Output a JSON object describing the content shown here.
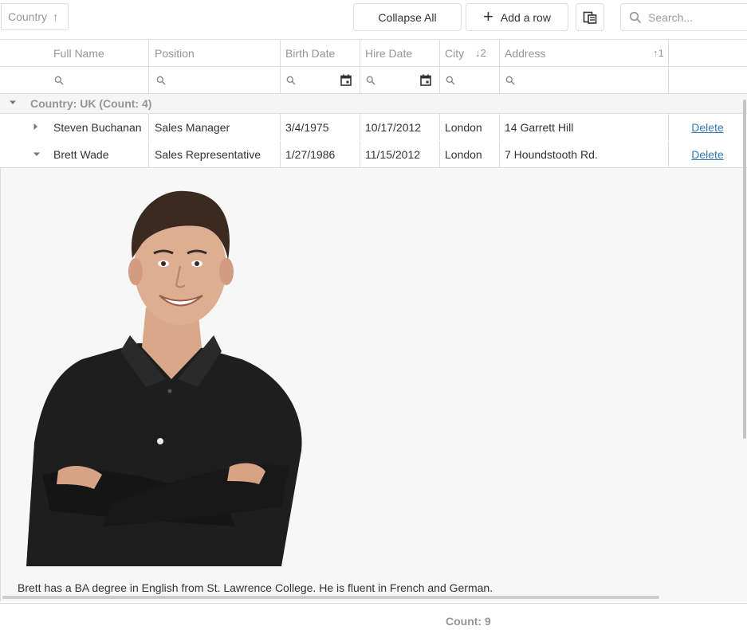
{
  "toolbar": {
    "group_panel_chip": "Country",
    "collapse_all_label": "Collapse All",
    "add_row_label": "Add a row",
    "search_placeholder": "Search..."
  },
  "columns": [
    {
      "label": "Full Name"
    },
    {
      "label": "Position"
    },
    {
      "label": "Birth Date"
    },
    {
      "label": "Hire Date"
    },
    {
      "label": "City",
      "sort_index": "2"
    },
    {
      "label": "Address",
      "sort_index": "1"
    }
  ],
  "group": {
    "label": "Country: UK (Count: 4)"
  },
  "rows": [
    {
      "full_name": "Steven Buchanan",
      "position": "Sales Manager",
      "birth_date": "3/4/1975",
      "hire_date": "10/17/2012",
      "city": "London",
      "address": "14 Garrett Hill",
      "action": "Delete",
      "expanded": false
    },
    {
      "full_name": "Brett Wade",
      "position": "Sales Representative",
      "birth_date": "1/27/1986",
      "hire_date": "11/15/2012",
      "city": "London",
      "address": "7 Houndstooth Rd.",
      "action": "Delete",
      "expanded": true
    }
  ],
  "detail": {
    "note": "Brett has a BA degree in English from St. Lawrence College. He is fluent in French and German."
  },
  "footer": {
    "summary": "Count: 9"
  },
  "colors": {
    "link": "#337ab7",
    "border": "#dddddd",
    "muted_text": "#959595",
    "detail_background": "#f7f7f7"
  }
}
